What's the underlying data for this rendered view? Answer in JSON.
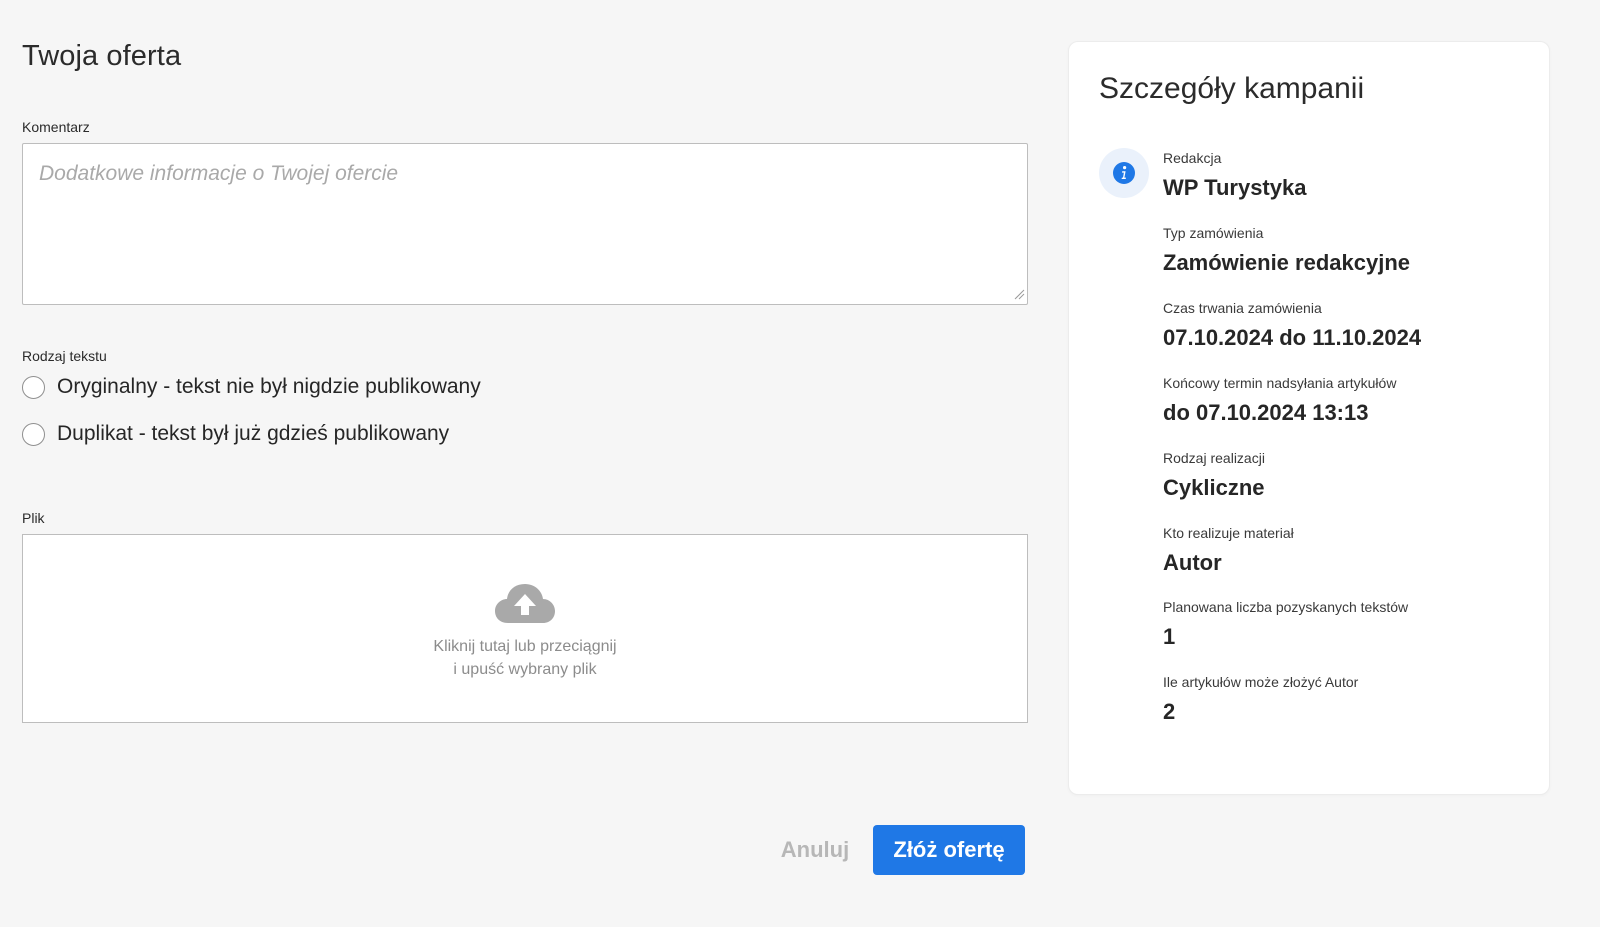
{
  "form": {
    "title": "Twoja oferta",
    "comment": {
      "label": "Komentarz",
      "placeholder": "Dodatkowe informacje o Twojej ofercie",
      "value": ""
    },
    "text_type": {
      "label": "Rodzaj tekstu",
      "options": [
        {
          "label": "Oryginalny - tekst nie był nigdzie publikowany",
          "selected": false
        },
        {
          "label": "Duplikat - tekst był już gdzieś publikowany",
          "selected": false
        }
      ]
    },
    "file": {
      "label": "Plik",
      "icon": "cloud-upload-icon",
      "hint_line1": "Kliknij tutaj lub przeciągnij",
      "hint_line2": "i upuść wybrany plik"
    },
    "actions": {
      "cancel": "Anuluj",
      "submit": "Złóż ofertę"
    }
  },
  "campaign": {
    "title": "Szczegóły kampanii",
    "icon": "info-icon",
    "details": [
      {
        "label": "Redakcja",
        "value": "WP Turystyka"
      },
      {
        "label": "Typ zamówienia",
        "value": "Zamówienie redakcyjne"
      },
      {
        "label": "Czas trwania zamówienia",
        "value": "07.10.2024 do 11.10.2024"
      },
      {
        "label": "Końcowy termin nadsyłania artykułów",
        "value": "do 07.10.2024 13:13"
      },
      {
        "label": "Rodzaj realizacji",
        "value": "Cykliczne"
      },
      {
        "label": "Kto realizuje materiał",
        "value": "Autor"
      },
      {
        "label": "Planowana liczba pozyskanych tekstów",
        "value": "1"
      },
      {
        "label": "Ile artykułów może złożyć Autor",
        "value": "2"
      }
    ]
  },
  "colors": {
    "background": "#f6f6f6",
    "primary": "#1f78e6",
    "info_badge_bg": "#eaf1fb",
    "muted_text": "#b7b7b7"
  }
}
